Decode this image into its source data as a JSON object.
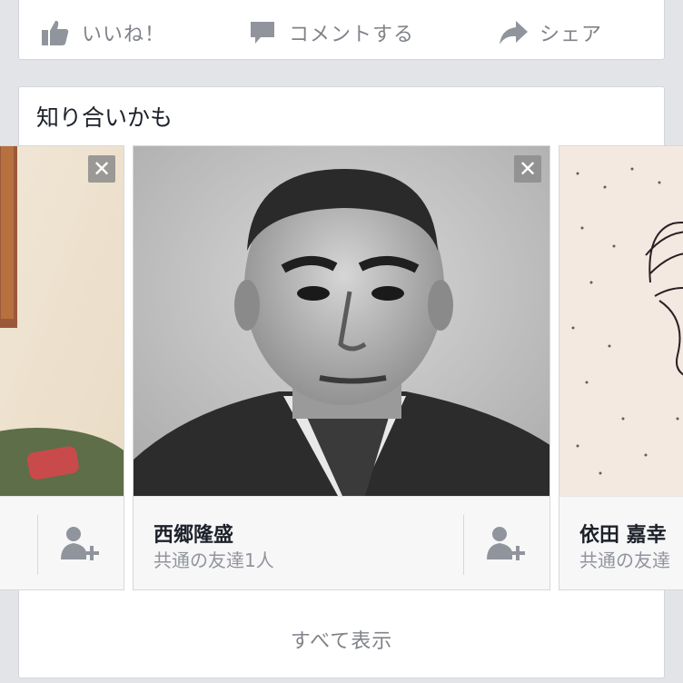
{
  "actions": {
    "like_label": "いいね！",
    "comment_label": "コメントする",
    "share_label": "シェア"
  },
  "pymk": {
    "title": "知り合いかも",
    "see_all_label": "すべて表示",
    "people": [
      {
        "name": "",
        "mutual": "",
        "close_label": ""
      },
      {
        "name": "西郷隆盛",
        "mutual": "共通の友達1人",
        "close_label": "✕"
      },
      {
        "name": "依田 嘉幸",
        "mutual": "共通の友達",
        "close_label": ""
      }
    ]
  },
  "colors": {
    "background": "#e3e4e8",
    "card": "#ffffff",
    "muted_text": "#7f8389",
    "icon_gray": "#90949c"
  },
  "icons": [
    "thumbs-up-icon",
    "comment-bubble-icon",
    "share-arrow-icon",
    "close-icon",
    "add-friend-icon"
  ]
}
